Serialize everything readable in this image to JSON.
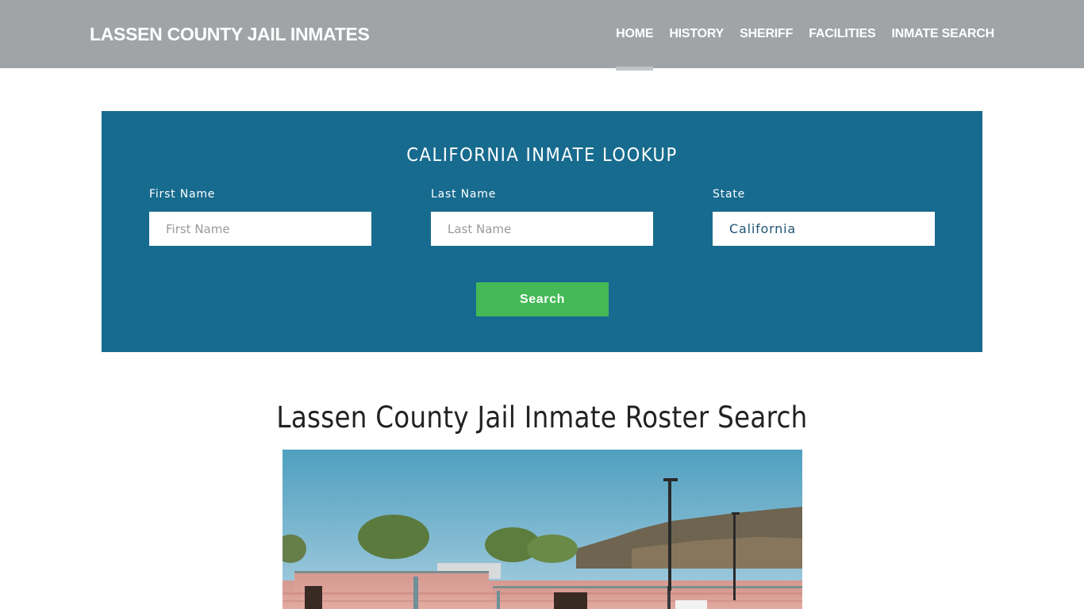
{
  "header": {
    "brand": "LASSEN COUNTY JAIL INMATES",
    "nav": [
      {
        "label": "HOME",
        "active": true
      },
      {
        "label": "HISTORY",
        "active": false
      },
      {
        "label": "SHERIFF",
        "active": false
      },
      {
        "label": "FACILITIES",
        "active": false
      },
      {
        "label": "INMATE SEARCH",
        "active": false
      }
    ]
  },
  "lookup": {
    "title": "CALIFORNIA INMATE LOOKUP",
    "first_name": {
      "label": "First Name",
      "placeholder": "First Name",
      "value": ""
    },
    "last_name": {
      "label": "Last Name",
      "placeholder": "Last Name",
      "value": ""
    },
    "state": {
      "label": "State",
      "selected": "California"
    },
    "search_label": "Search",
    "colors": {
      "panel": "#176b8e",
      "button": "#44b956"
    }
  },
  "main": {
    "heading": "Lassen County Jail Inmate Roster Search",
    "photo_alt": "Lassen County Jail building"
  }
}
